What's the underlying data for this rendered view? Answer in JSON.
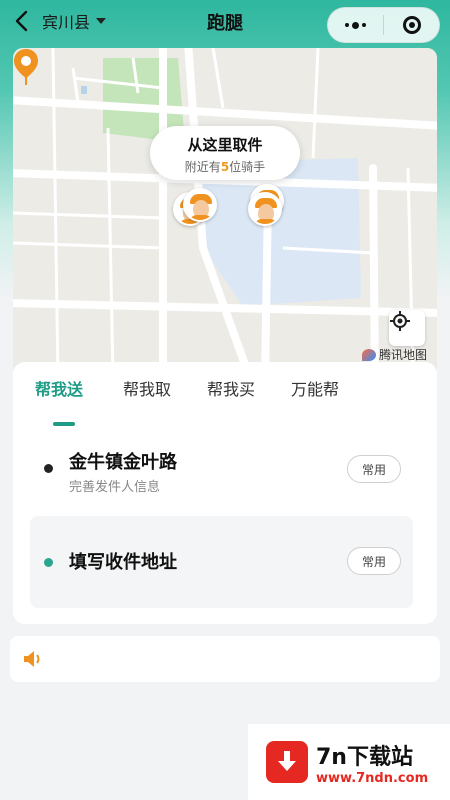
{
  "header": {
    "city": "宾川县",
    "title": "跑腿"
  },
  "map": {
    "pickup_title": "从这里取件",
    "pickup_sub_prefix": "附近有",
    "rider_count": "5",
    "pickup_sub_suffix": "位骑手",
    "logo_text": "腾讯地图"
  },
  "tabs": [
    {
      "label": "帮我送",
      "active": true
    },
    {
      "label": "帮我取",
      "active": false
    },
    {
      "label": "帮我买",
      "active": false
    },
    {
      "label": "万能帮",
      "active": false
    }
  ],
  "sender": {
    "address": "金牛镇金叶路",
    "hint": "完善发件人信息",
    "common_label": "常用"
  },
  "receiver": {
    "address": "填写收件地址",
    "common_label": "常用"
  },
  "watermark": {
    "title": "7n下载站",
    "url": "www.7ndn.com"
  },
  "colors": {
    "brand": "#1e9c86",
    "sender_dot": "#222222",
    "receiver_dot": "#2aa58f",
    "accent_orange": "#f0921f"
  },
  "icons": {
    "back": "chevron-left-icon",
    "locate": "crosshair-icon",
    "notice": "speaker-icon"
  }
}
